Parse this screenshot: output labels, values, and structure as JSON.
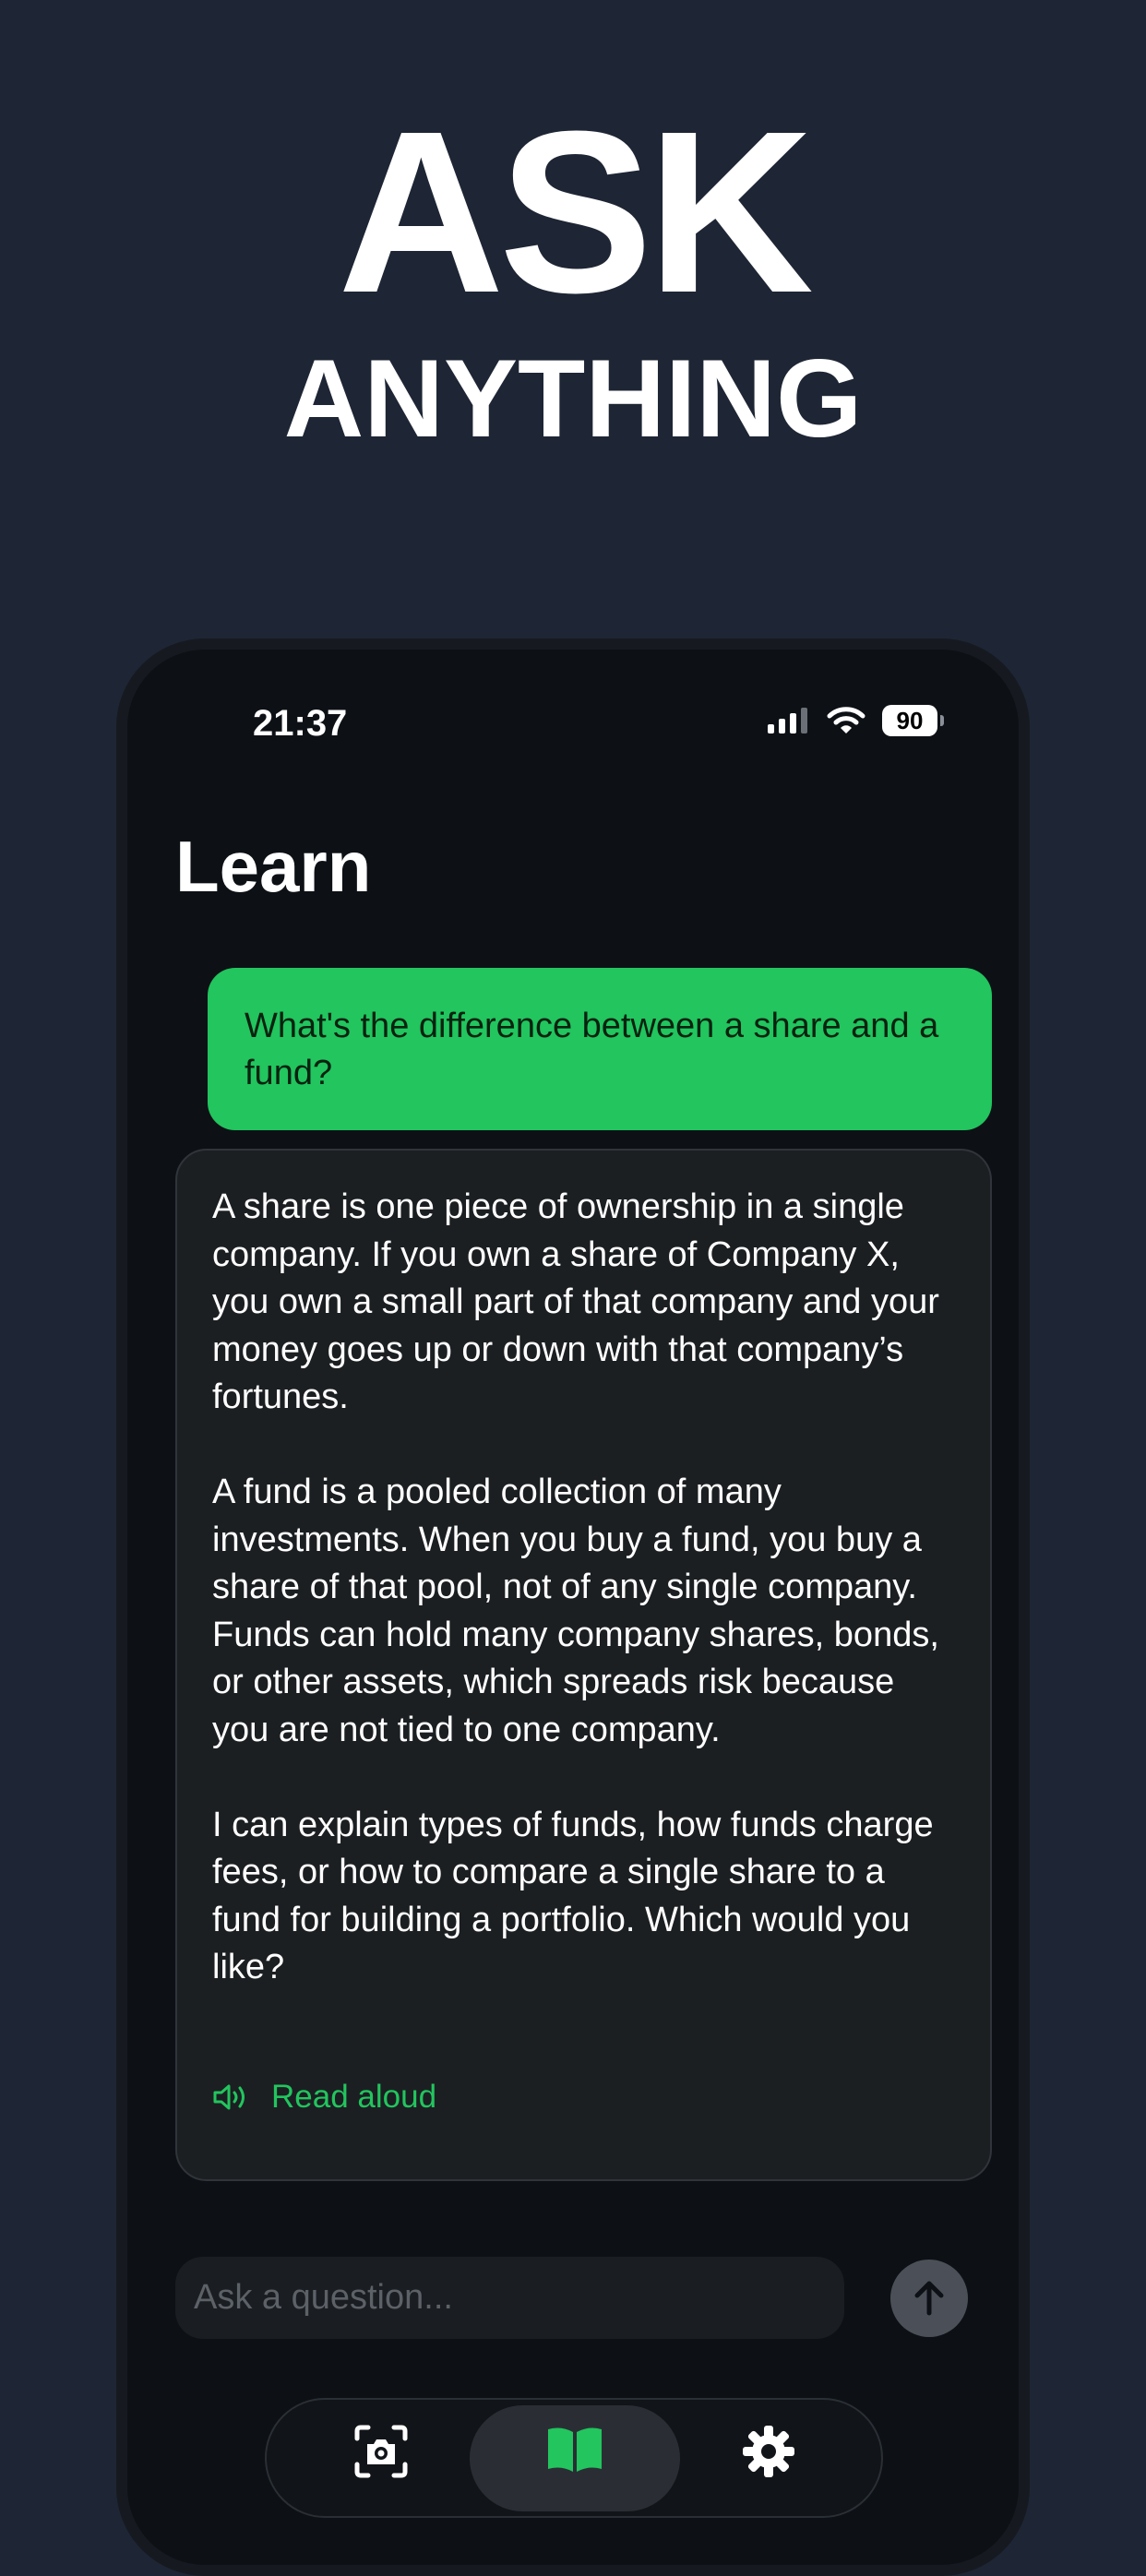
{
  "hero": {
    "title": "ASK",
    "subtitle": "ANYTHING"
  },
  "status_bar": {
    "time": "21:37",
    "battery": "90"
  },
  "page": {
    "title": "Learn"
  },
  "chat": {
    "user_message": "What's the difference between a share and a fund?",
    "reply_paragraphs": [
      "A share is one piece of ownership in a single company. If you own a share of Company X, you own a small part of that company and your money goes up or down with that company’s fortunes.",
      "A fund is a pooled collection of many investments. When you buy a fund, you buy a share of that pool, not of any single company. Funds can hold many company shares, bonds, or other assets, which spreads risk because you are not tied to one company.",
      "I can explain types of funds, how funds charge fees, or how to compare a single share to a fund for building a portfolio. Which would you like?"
    ],
    "read_aloud_label": "Read aloud"
  },
  "composer": {
    "placeholder": "Ask a question..."
  },
  "tabs": [
    {
      "icon": "camera-scan-icon"
    },
    {
      "icon": "open-book-icon",
      "active": true
    },
    {
      "icon": "gear-icon"
    }
  ],
  "colors": {
    "background": "#1e2635",
    "accent": "#22c55e",
    "screen": "#0d1116",
    "card": "#1c1f22"
  }
}
